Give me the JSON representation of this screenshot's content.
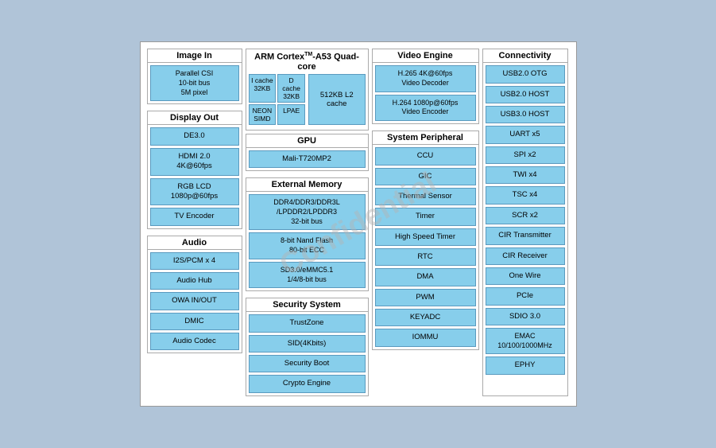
{
  "diagram": {
    "watermark": "Confidential",
    "arm": {
      "title": "ARM Cortex",
      "tm": "TM",
      "subtitle": "-A53  Quad-core",
      "icache": "I cache\n32KB",
      "dcache": "D cache\n32KB",
      "neon_simd": "NEON\nSIMD",
      "lpae": "LPAE",
      "l2": "512KB L2 cache"
    },
    "imageIn": {
      "title": "Image In",
      "parallel_csi": "Parallel CSI\n10-bit bus\n5M pixel"
    },
    "displayOut": {
      "title": "Display Out",
      "de30": "DE3.0",
      "hdmi": "HDMI 2.0\n4K@60fps",
      "rgb_lcd": "RGB LCD\n1080p@60fps",
      "tv_encoder": "TV Encoder"
    },
    "audio": {
      "title": "Audio",
      "i2s": "I2S/PCM x 4",
      "audio_hub": "Audio Hub",
      "owa": "OWA IN/OUT",
      "dmic": "DMIC",
      "audio_codec": "Audio Codec"
    },
    "gpu": {
      "title": "GPU",
      "mali": "Mali-T720MP2"
    },
    "extMem": {
      "title": "External Memory",
      "ddr": "DDR4/DDR3/DDR3L\n/LPDDR2/LPDDR3\n32-bit bus",
      "nand": "8-bit Nand Flash\n80-bit ECC",
      "sd": "SD3.0/eMMC5.1\n1/4/8-bit bus"
    },
    "security": {
      "title": "Security System",
      "trustzone": "TrustZone",
      "sid": "SID(4Kbits)",
      "security_boot": "Security Boot",
      "crypto_engine": "Crypto Engine"
    },
    "videoEngine": {
      "title": "Video Engine",
      "h265": "H.265  4K@60fps\nVideo Decoder",
      "h264": "H.264 1080p@60fps\nVideo Encoder"
    },
    "sysPeri": {
      "title": "System Peripheral",
      "ccu": "CCU",
      "gic": "GIC",
      "thermal": "Thermal Sensor",
      "timer": "Timer",
      "high_speed_timer": "High Speed Timer",
      "rtc": "RTC",
      "dma": "DMA",
      "pwm": "PWM",
      "keyadc": "KEYADC",
      "iommu": "IOMMU"
    },
    "connectivity": {
      "title": "Connectivity",
      "usb2_otg": "USB2.0 OTG",
      "usb2_host": "USB2.0 HOST",
      "usb3_host": "USB3.0 HOST",
      "uart": "UART x5",
      "spi": "SPI x2",
      "twi": "TWI x4",
      "tsc": "TSC x4",
      "scr": "SCR x2",
      "cir_tx": "CIR Transmitter",
      "cir_rx": "CIR Receiver",
      "one_wire": "One Wire",
      "pcie": "PCIe",
      "sdio": "SDIO 3.0",
      "emac": "EMAC\n10/100/1000MHz",
      "ephy": "EPHY"
    }
  }
}
